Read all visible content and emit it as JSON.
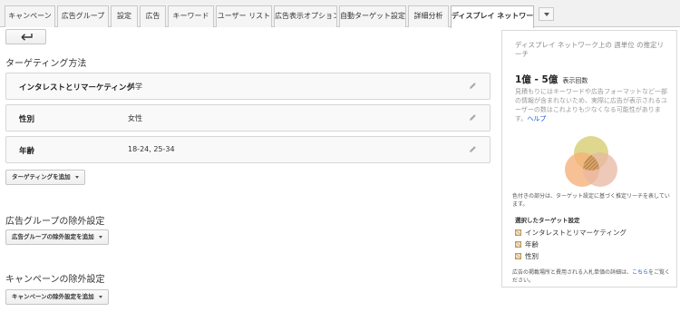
{
  "tabs": [
    {
      "label": "キャンペーン"
    },
    {
      "label": "広告グループ"
    },
    {
      "label": "設定"
    },
    {
      "label": "広告"
    },
    {
      "label": "キーワード"
    },
    {
      "label": "ユーザー リスト"
    },
    {
      "label": "広告表示オプション"
    },
    {
      "label": "自動ターゲット設定"
    },
    {
      "label": "詳細分析"
    },
    {
      "label": "ディスプレイ ネットワーク",
      "active": true
    }
  ],
  "main": {
    "targeting_title": "ターゲティング方法",
    "rows": [
      {
        "label": "インタレストとリマーケティング",
        "value": "科学"
      },
      {
        "label": "性別",
        "value": "女性"
      },
      {
        "label": "年齢",
        "value": "18-24, 25-34"
      }
    ],
    "add_targeting_label": "ターゲティングを追加",
    "adgroup_exclusion_title": "広告グループの除外設定",
    "adgroup_exclusion_button": "広告グループの除外設定を追加",
    "campaign_exclusion_title": "キャンペーンの除外設定",
    "campaign_exclusion_button": "キャンペーンの除外設定を追加"
  },
  "sidebar": {
    "title": "ディスプレイ ネットワーク上の 週単位 の推定リーチ",
    "reach_value": "1億 - 5億",
    "reach_unit": "表示回数",
    "note": "見積もりにはキーワードや広告フォーマットなど一部の情報が含まれないため、実際に広告が表示されるユーザーの数はこれよりも少なくなる可能性があります。",
    "note_link": "ヘルプ",
    "caption": "色付きの部分は、ターゲット設定に基づく推定リーチを表しています。",
    "selected_title": "選択したターゲット設定",
    "selected_items": [
      "インタレストとリマーケティング",
      "年齢",
      "性別"
    ],
    "footer": "広告の掲載場所と費用される入札単価の詳細は、",
    "footer_link": "こちら",
    "footer_tail": "をご覧ください。"
  },
  "colors": {
    "venn_interest": "#d9d07a",
    "venn_age": "#f5b27a",
    "venn_gender": "#e8b7a3",
    "link": "#1155cc"
  },
  "icons": {
    "back": "arrow-left-icon",
    "edit": "pencil-icon",
    "more": "chevron-down-icon"
  }
}
